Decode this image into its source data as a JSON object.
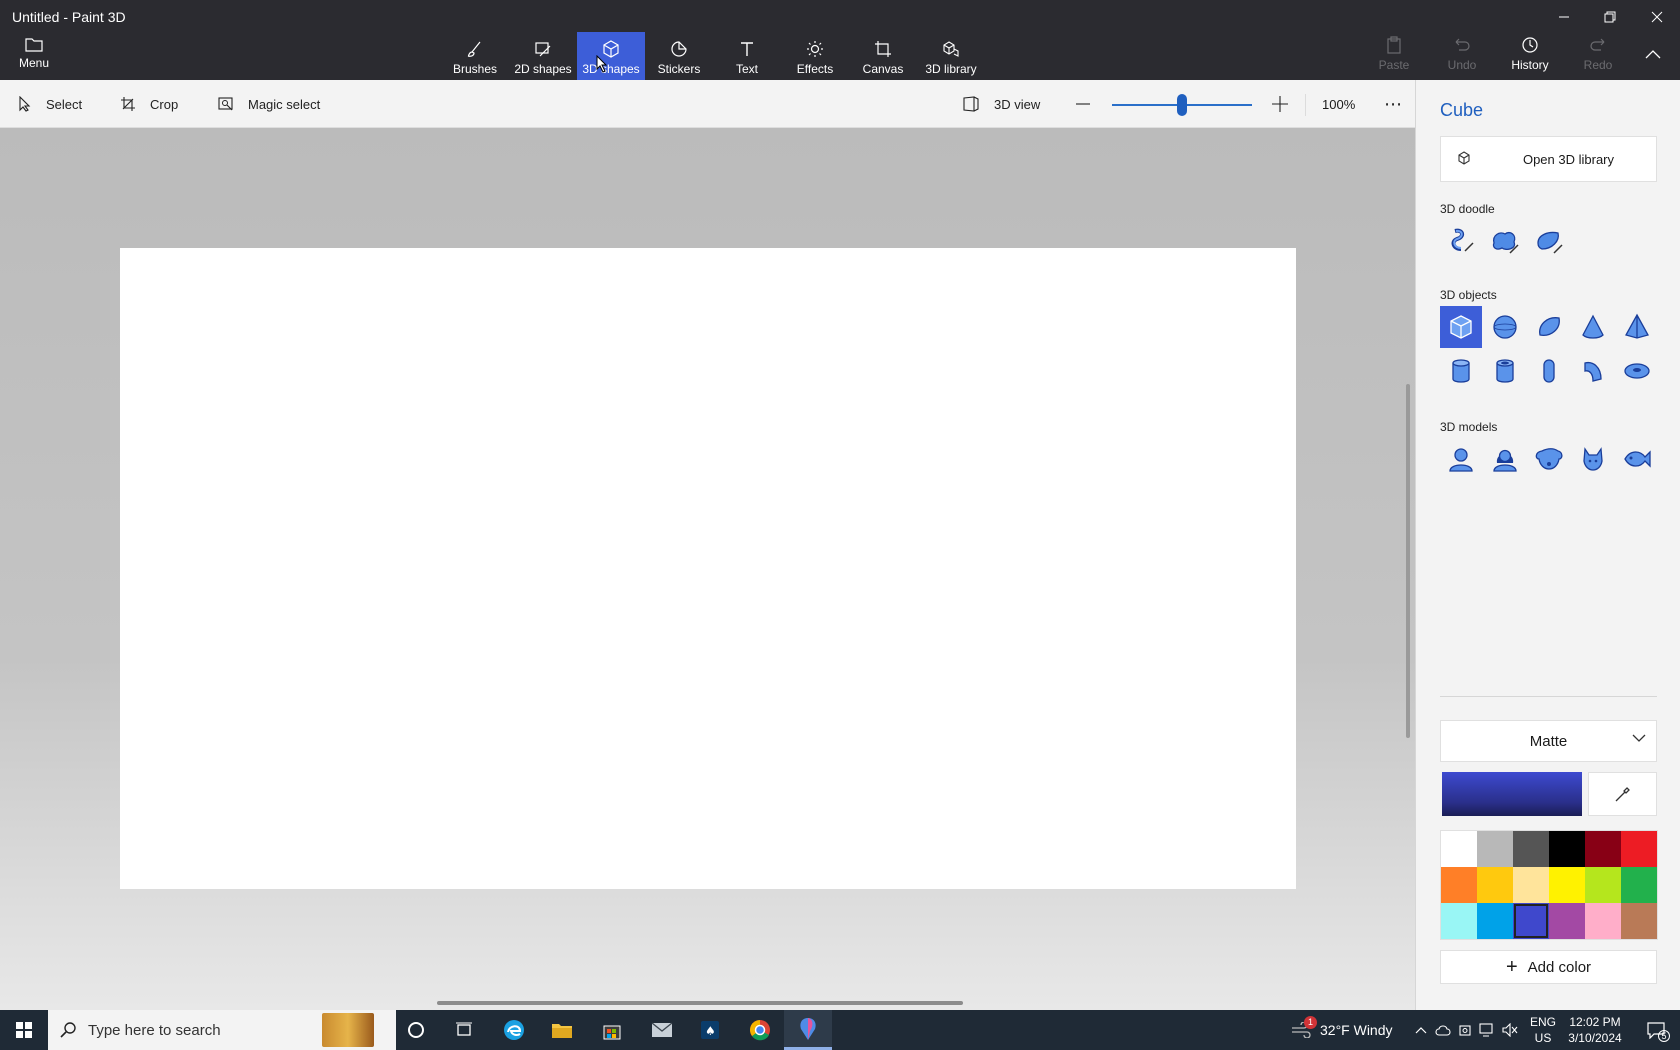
{
  "window": {
    "title": "Untitled - Paint 3D"
  },
  "ribbon": {
    "menu_label": "Menu",
    "tabs": [
      {
        "label": "Brushes",
        "icon": "brush-icon"
      },
      {
        "label": "2D shapes",
        "icon": "2d-shapes-icon"
      },
      {
        "label": "3D shapes",
        "icon": "3d-shapes-icon",
        "active": true
      },
      {
        "label": "Stickers",
        "icon": "stickers-icon"
      },
      {
        "label": "Text",
        "icon": "text-icon"
      },
      {
        "label": "Effects",
        "icon": "effects-icon"
      },
      {
        "label": "Canvas",
        "icon": "canvas-icon"
      },
      {
        "label": "3D library",
        "icon": "3d-library-icon"
      }
    ],
    "actions": [
      {
        "label": "Paste",
        "enabled": false
      },
      {
        "label": "Undo",
        "enabled": false
      },
      {
        "label": "History",
        "enabled": true
      },
      {
        "label": "Redo",
        "enabled": false
      }
    ]
  },
  "toolbar": {
    "select_label": "Select",
    "crop_label": "Crop",
    "magic_select_label": "Magic select",
    "view_3d_label": "3D view",
    "zoom_percent": "100%",
    "zoom_level": 0.5,
    "more_label": "⋯"
  },
  "panel": {
    "title": "Cube",
    "open_library_label": "Open 3D library",
    "doodle_heading": "3D doodle",
    "objects_heading": "3D objects",
    "models_heading": "3D models",
    "material": "Matte",
    "current_color": "#3d4ad0",
    "add_color_label": "Add color",
    "palette": [
      "#ffffff",
      "#b8b8b8",
      "#555555",
      "#000000",
      "#880015",
      "#ed1c24",
      "#ff7f27",
      "#ffc90e",
      "#ffe49b",
      "#fff200",
      "#b5e61d",
      "#22b14c",
      "#99f6f5",
      "#00a2e8",
      "#3f48cc",
      "#a349a4",
      "#ffaec9",
      "#b97a57"
    ],
    "selected_swatch": 14
  },
  "taskbar": {
    "search_placeholder": "Type here to search",
    "weather": "32°F  Windy",
    "weather_badge": "1",
    "lang_top": "ENG",
    "lang_bottom": "US",
    "time": "12:02 PM",
    "date": "3/10/2024",
    "notification_count": "5"
  },
  "colors": {
    "accent": "#3d5ed8",
    "ribbon_bg": "#2b2b30",
    "panel_title": "#1f5fbf"
  }
}
